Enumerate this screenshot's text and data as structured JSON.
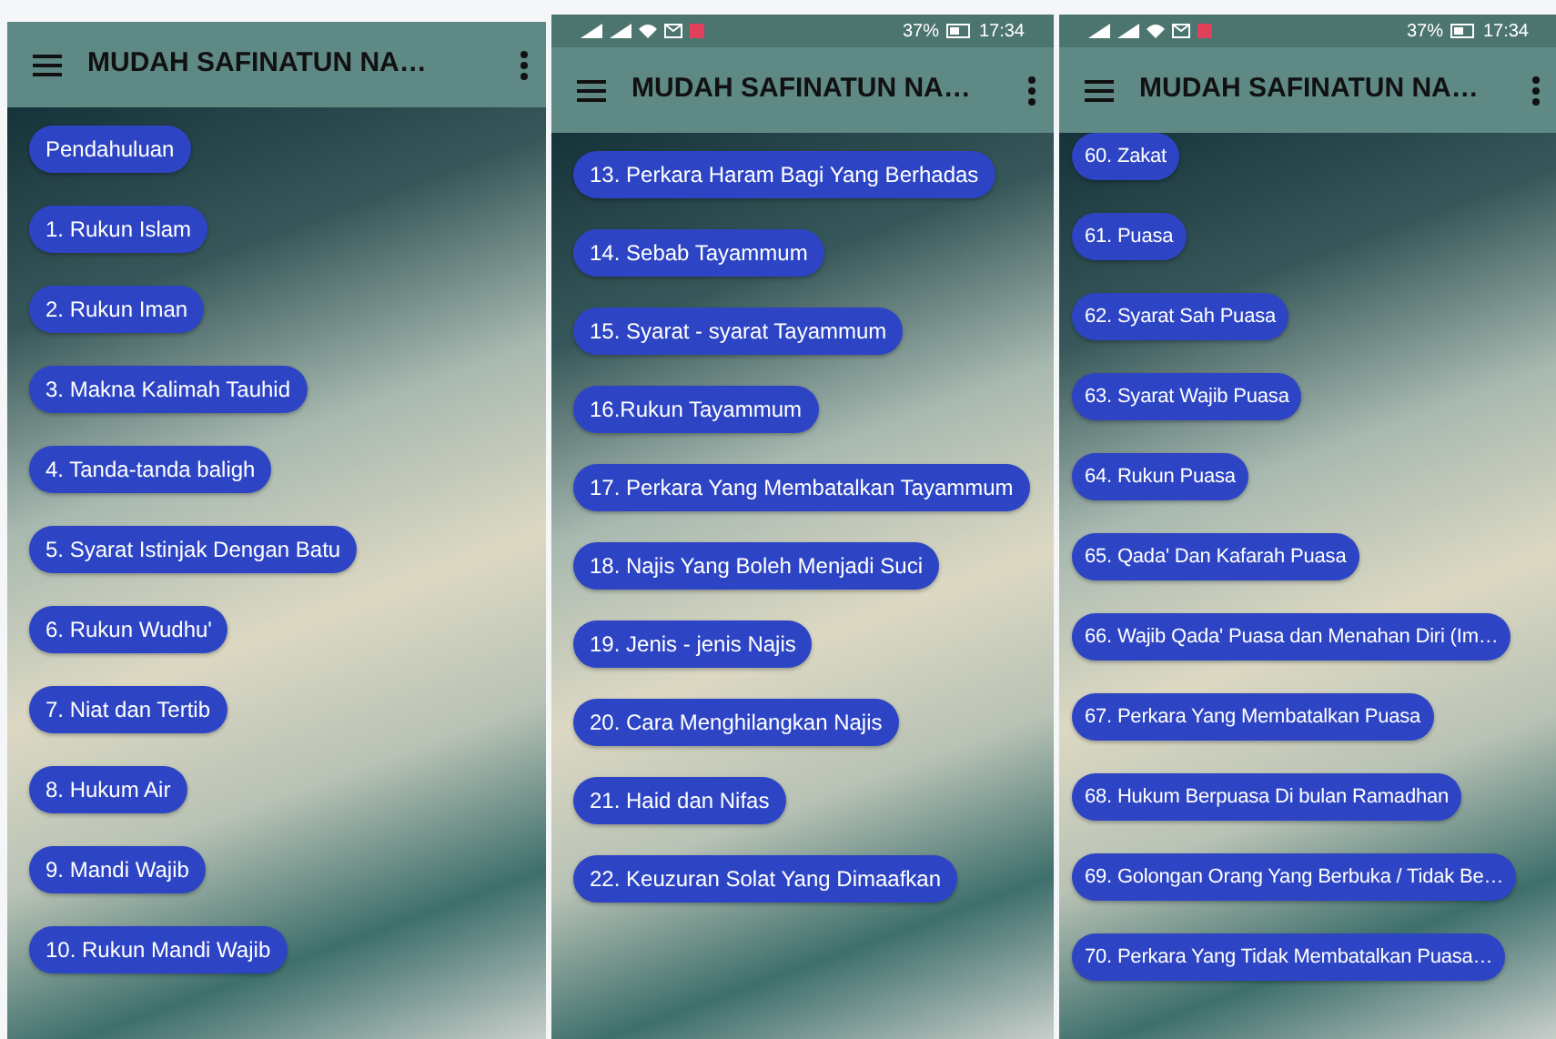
{
  "panels": [
    {
      "toolbar": {
        "title": "MUDAH SAFINATUN NA…"
      },
      "items": [
        {
          "label": "Pendahuluan"
        },
        {
          "label": "1. Rukun Islam"
        },
        {
          "label": "2. Rukun Iman"
        },
        {
          "label": "3. Makna Kalimah Tauhid"
        },
        {
          "label": "4. Tanda-tanda baligh"
        },
        {
          "label": "5. Syarat Istinjak Dengan Batu"
        },
        {
          "label": "6. Rukun Wudhu'"
        },
        {
          "label": "7. Niat dan Tertib"
        },
        {
          "label": "8. Hukum Air"
        },
        {
          "label": "9. Mandi Wajib"
        },
        {
          "label": "10. Rukun Mandi Wajib"
        }
      ]
    },
    {
      "status_bar": {
        "battery": "37%",
        "time": "17:34"
      },
      "toolbar": {
        "title": "MUDAH SAFINATUN NA…"
      },
      "items": [
        {
          "label": "13. Perkara Haram Bagi Yang Berhadas"
        },
        {
          "label": "14. Sebab Tayammum"
        },
        {
          "label": "15. Syarat - syarat Tayammum"
        },
        {
          "label": "16.Rukun Tayammum"
        },
        {
          "label": "17. Perkara Yang Membatalkan Tayammum"
        },
        {
          "label": "18. Najis Yang Boleh Menjadi Suci"
        },
        {
          "label": "19. Jenis - jenis Najis"
        },
        {
          "label": "20. Cara Menghilangkan Najis"
        },
        {
          "label": "21. Haid dan Nifas"
        },
        {
          "label": "22. Keuzuran Solat Yang Dimaafkan"
        }
      ]
    },
    {
      "status_bar": {
        "battery": "37%",
        "time": "17:34"
      },
      "toolbar": {
        "title": "MUDAH SAFINATUN NA…"
      },
      "items": [
        {
          "label": "60. Zakat"
        },
        {
          "label": "61. Puasa"
        },
        {
          "label": "62. Syarat Sah Puasa"
        },
        {
          "label": "63. Syarat Wajib Puasa"
        },
        {
          "label": "64. Rukun Puasa"
        },
        {
          "label": "65. Qada' Dan Kafarah Puasa"
        },
        {
          "label": "66. Wajib Qada' Puasa dan Menahan Diri (Im…"
        },
        {
          "label": "67. Perkara Yang Membatalkan Puasa"
        },
        {
          "label": "68. Hukum Berpuasa Di bulan Ramadhan"
        },
        {
          "label": "69. Golongan Orang Yang Berbuka / Tidak Be…"
        },
        {
          "label": "70. Perkara Yang Tidak Membatalkan Puasa…"
        }
      ]
    }
  ]
}
